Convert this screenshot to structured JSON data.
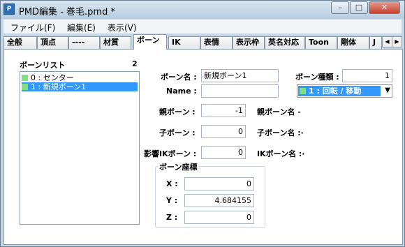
{
  "window": {
    "title": "PMD編集 - 巻毛.pmd *",
    "app_icon_text": "P",
    "buttons": {
      "minimize": "–",
      "maximize": "□",
      "close": "✕"
    }
  },
  "menu": [
    "ファイル(F)",
    "編集(E)",
    "表示(V)"
  ],
  "tabs": [
    "全般",
    "頂点",
    "----",
    "材質",
    "ボーン",
    "IK",
    "表情",
    "表示枠",
    "英名対応",
    "Toon",
    "剛体",
    "J"
  ],
  "active_tab": "ボーン",
  "tab_scroll": {
    "left": "◀",
    "right": "▶"
  },
  "bone_list": {
    "label": "ボーンリスト",
    "count": "2",
    "items": [
      {
        "text": "0 : センター",
        "swatch": "#7ee07e",
        "selected": false
      },
      {
        "text": "1 : 新規ボーン1",
        "swatch": "#7ee07e",
        "selected": true
      }
    ]
  },
  "form": {
    "bone_name_label": "ボーン名 :",
    "bone_name_value": "新規ボーン1",
    "name_en_label": "Name :",
    "name_en_value": "",
    "bone_type_label": "ボーン種類 :",
    "bone_type_value": "1",
    "bone_type_selected": "1 : 回転 / 移動",
    "bone_type_swatch": "#7ee07e",
    "dropdown_arrow": "▼",
    "parent_label": "親ボーン :",
    "parent_value": "-1",
    "parent_name_label": "親ボーン名 -",
    "child_label": "子ボーン :",
    "child_value": "0",
    "child_name_label": "子ボーン名 :·",
    "ik_label": "影響IKボーン :",
    "ik_value": "0",
    "ik_name_label": "IKボーン名 :·"
  },
  "coords": {
    "label": "ボーン座標",
    "x_label": "X :",
    "x_value": "0",
    "y_label": "Y :",
    "y_value": "4.684155",
    "z_label": "Z :",
    "z_value": "0"
  }
}
